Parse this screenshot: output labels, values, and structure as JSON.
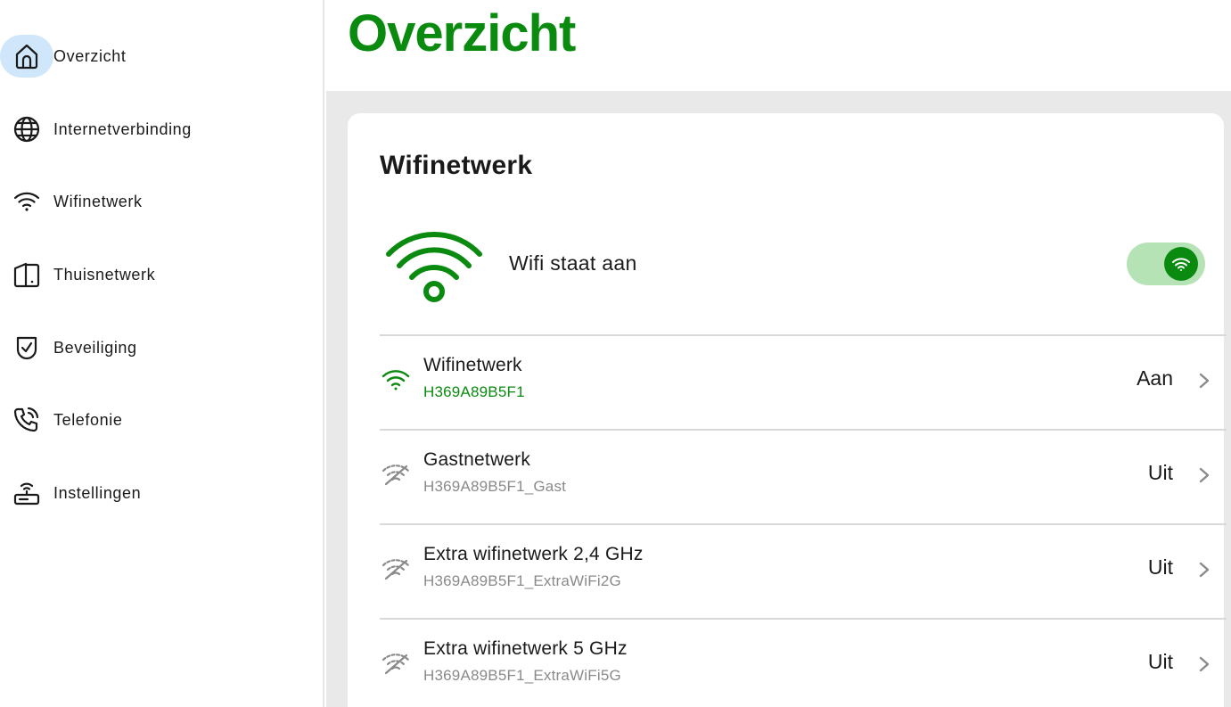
{
  "sidebar": {
    "items": [
      {
        "label": "Overzicht",
        "icon": "home-icon",
        "active": true
      },
      {
        "label": "Internetverbinding",
        "icon": "globe-icon"
      },
      {
        "label": "Wifinetwerk",
        "icon": "wifi-icon"
      },
      {
        "label": "Thuisnetwerk",
        "icon": "devices-icon"
      },
      {
        "label": "Beveiliging",
        "icon": "shield-check-icon"
      },
      {
        "label": "Telefonie",
        "icon": "phone-icon"
      },
      {
        "label": "Instellingen",
        "icon": "router-icon"
      }
    ]
  },
  "header": {
    "title": "Overzicht"
  },
  "card": {
    "title": "Wifinetwerk",
    "wifi_status": "Wifi staat aan",
    "wifi_enabled": true,
    "rows": [
      {
        "title": "Wifinetwerk",
        "ssid": "H369A89B5F1",
        "status": "Aan",
        "active": true
      },
      {
        "title": "Gastnetwerk",
        "ssid": "H369A89B5F1_Gast",
        "status": "Uit",
        "active": false
      },
      {
        "title": "Extra wifinetwerk 2,4 GHz",
        "ssid": "H369A89B5F1_ExtraWiFi2G",
        "status": "Uit",
        "active": false
      },
      {
        "title": "Extra wifinetwerk 5 GHz",
        "ssid": "H369A89B5F1_ExtraWiFi5G",
        "status": "Uit",
        "active": false
      }
    ]
  },
  "colors": {
    "brand_green": "#0b8a10",
    "toggle_track": "#b5e3b5",
    "active_nav_bg": "#cfe6fb",
    "muted_text": "#8a8a8a"
  }
}
